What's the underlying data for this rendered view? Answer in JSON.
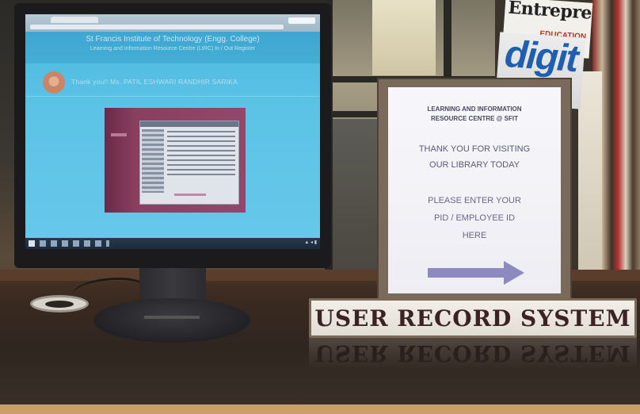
{
  "screen": {
    "site_title": "St Francis Institute of Technology (Engg. College)",
    "site_subtitle": "Learning and Information Resource Centre (LIRC) In / Out Register",
    "thanks_message": "Thank you!! Ms. PATIL ESHWARI RANDHIR SARIKA"
  },
  "sign": {
    "heading_line1": "LEARNING AND INFORMATION",
    "heading_line2": "RESOURCE CENTRE @ SFIT",
    "thanks_line1": "THANK YOU FOR VISITING",
    "thanks_line2": "OUR LIBRARY TODAY",
    "prompt_line1": "PLEASE ENTER YOUR",
    "prompt_line2": "PID / EMPLOYEE ID",
    "prompt_line3": "HERE",
    "arrow_icon": "right-arrow-icon",
    "arrow_color": "#8e8ac0"
  },
  "nameplate": {
    "label": "USER RECORD SYSTEM"
  },
  "magazines": {
    "entrepreneur_title": "Entrepreneur",
    "entrepreneur_tag": "EDUCATION",
    "digit_title": "digit"
  }
}
